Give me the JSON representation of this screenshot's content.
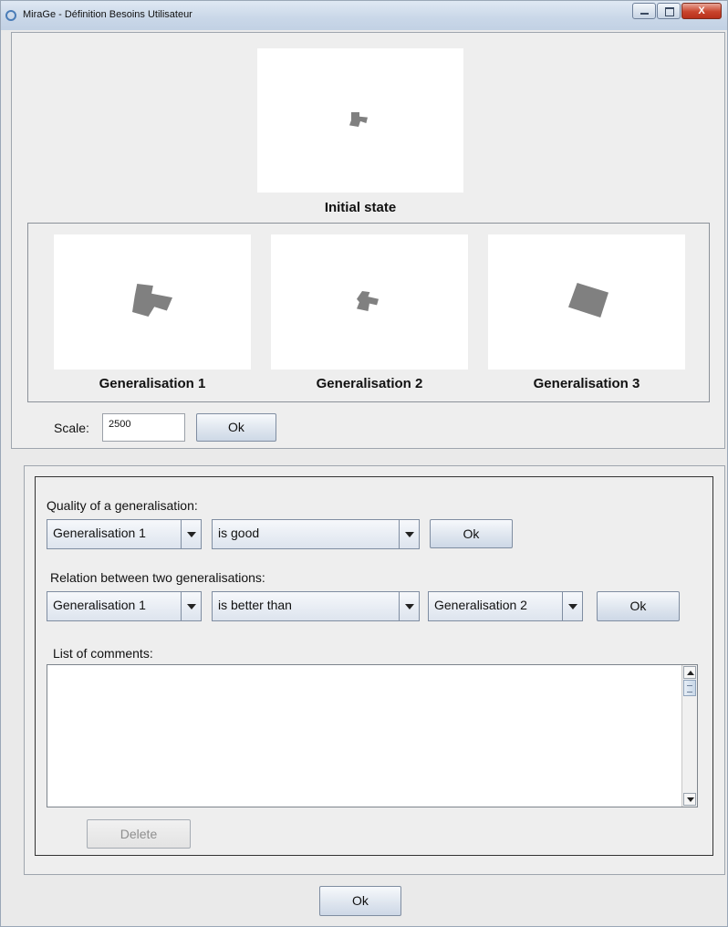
{
  "window": {
    "title": "MiraGe - Définition Besoins Utilisateur",
    "close_glyph": "X"
  },
  "top_panel": {
    "initial_state": {
      "caption": "Initial state"
    },
    "generalisations": [
      {
        "caption": "Generalisation 1"
      },
      {
        "caption": "Generalisation 2"
      },
      {
        "caption": "Generalisation 3"
      }
    ],
    "scale": {
      "label": "Scale:",
      "value": "2500",
      "ok_label": "Ok"
    }
  },
  "evaluation_panel": {
    "quality": {
      "label": "Quality of a generalisation:",
      "generalisation_selected": "Generalisation 1",
      "judgement_selected": "is good",
      "ok_label": "Ok"
    },
    "relation": {
      "label": "Relation between two generalisations:",
      "first_selected": "Generalisation 1",
      "relation_selected": "is better than",
      "second_selected": "Generalisation 2",
      "ok_label": "Ok"
    },
    "comments": {
      "label": "List of comments:",
      "items": [],
      "delete_label": "Delete"
    }
  },
  "footer": {
    "ok_label": "Ok"
  },
  "icons": [
    "app-icon",
    "minimize-icon",
    "maximize-icon",
    "close-icon",
    "dropdown-arrow-icon",
    "scroll-up-icon",
    "scroll-down-icon"
  ]
}
